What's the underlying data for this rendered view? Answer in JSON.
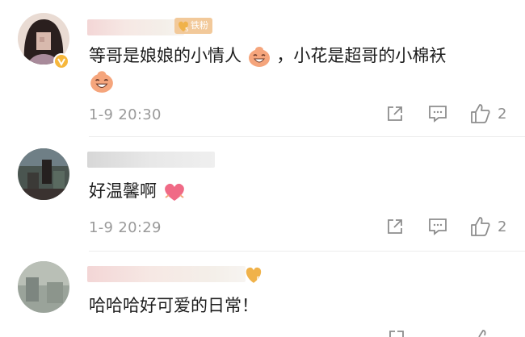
{
  "comments": [
    {
      "badge": "铁粉",
      "text_part1": "等哥是娘娘的小情人",
      "text_part2": "，小花是超哥的小棉袄",
      "time": "1-9 20:30",
      "likes": "2"
    },
    {
      "text": "好温馨啊",
      "time": "1-9 20:29",
      "likes": "2"
    },
    {
      "text": "哈哈哈好可爱的日常！"
    }
  ],
  "colors": {
    "accent_gold": "#f0b24a",
    "heart_pink": "#f06a86",
    "icon_gray": "#8d8d8d"
  }
}
